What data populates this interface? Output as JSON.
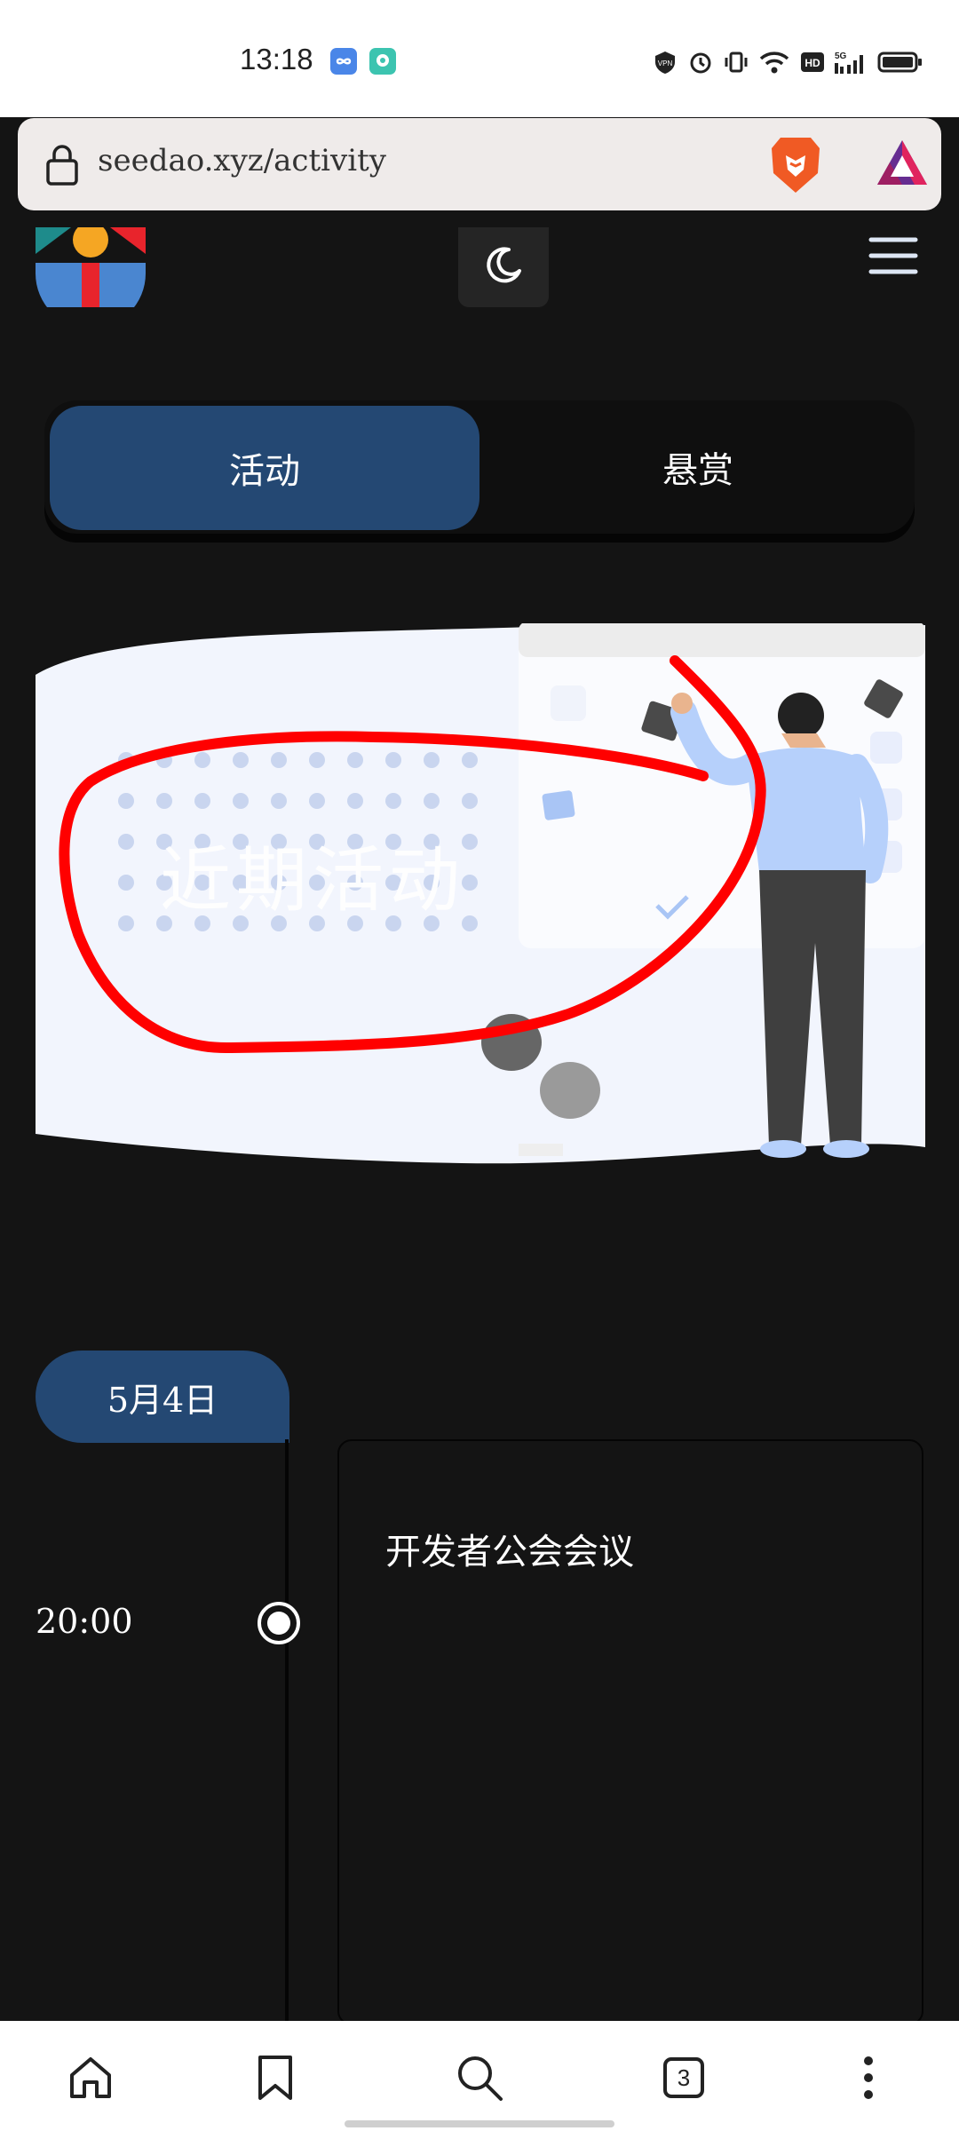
{
  "status_bar": {
    "time": "13:18",
    "icons": [
      "vpn-icon",
      "alarm-icon",
      "vibrate-icon",
      "wifi-icon",
      "hd-icon",
      "5g-signal-icon",
      "battery-icon"
    ]
  },
  "browser": {
    "url": "seedao.xyz/activity"
  },
  "tabs": {
    "activity": "活动",
    "bounty": "悬赏"
  },
  "banner": {
    "title": "近期活动"
  },
  "timeline": {
    "date": "5月4日",
    "events": [
      {
        "time": "20:00",
        "title": "开发者公会会议"
      }
    ]
  },
  "bottom_nav": {
    "tab_count": "3"
  },
  "colors": {
    "accent": "#244873",
    "background": "#141414",
    "annotation": "#ff0000"
  }
}
